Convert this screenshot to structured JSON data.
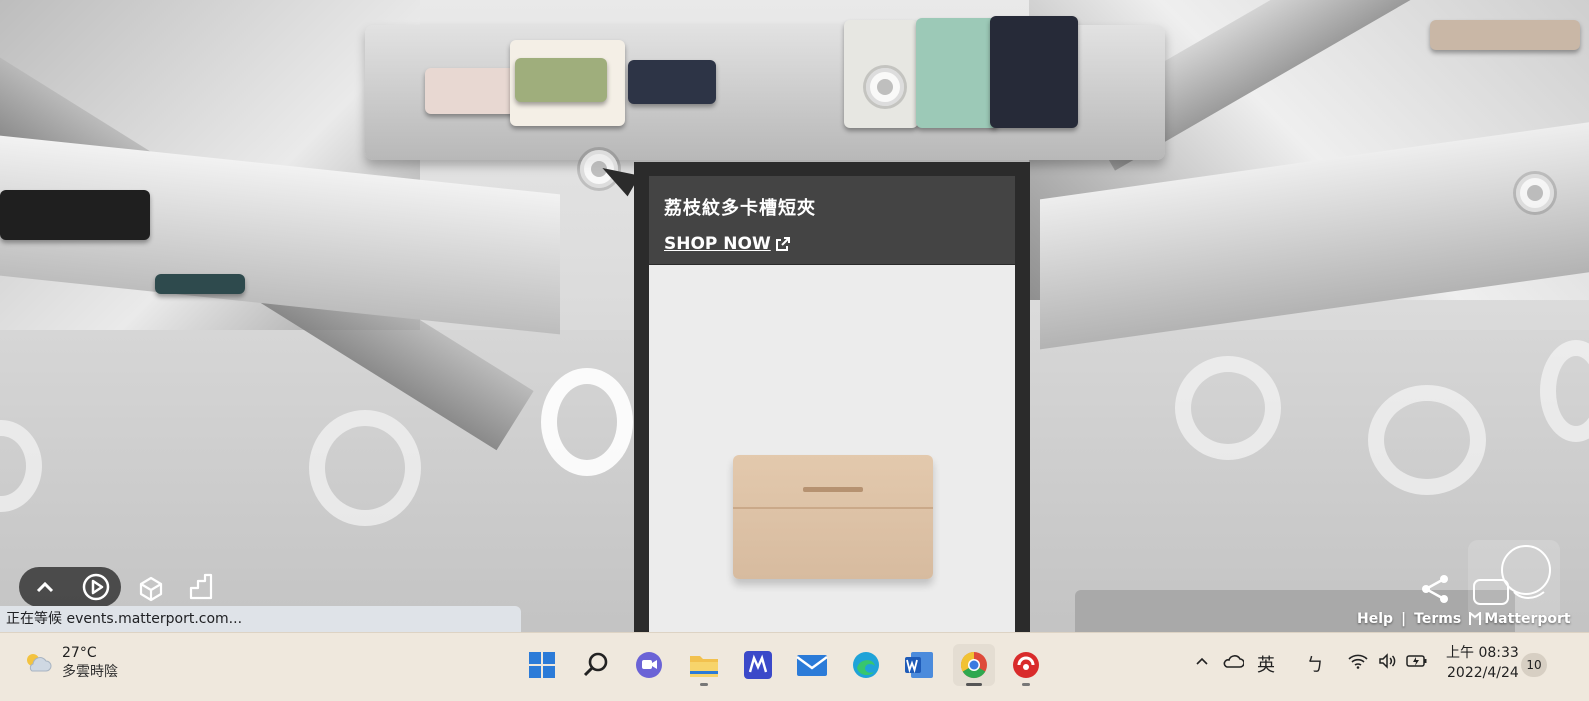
{
  "product_popup": {
    "title": "荔枝紋多卡槽短夾",
    "shop_label": "SHOP NOW"
  },
  "viewer": {
    "status_text": "正在等候 events.matterport.com...",
    "help_label": "Help",
    "separator": "|",
    "terms_label": "Terms",
    "brand_label": "Matterport"
  },
  "taskbar": {
    "weather_temp": "27°C",
    "weather_desc": "多雲時陰",
    "ime_label": "英",
    "ime_mode": "ㄅ",
    "time": "上午 08:33",
    "date": "2022/4/24",
    "notification_count": "10"
  },
  "colors": {
    "popup_bg": "#2b2b2b",
    "popup_head": "#444444",
    "taskbar_bg": "#efe8dd",
    "progress": "#2cc64a"
  },
  "icons": {
    "controls": [
      "chevron-up-icon",
      "play-icon",
      "dollhouse-icon",
      "floorplan-icon"
    ],
    "taskbar_apps": [
      "windows-start-icon",
      "search-icon",
      "teams-chat-icon",
      "file-explorer-icon",
      "app-m-icon",
      "mail-icon",
      "edge-icon",
      "word-icon",
      "chrome-icon",
      "app-red-icon"
    ]
  }
}
